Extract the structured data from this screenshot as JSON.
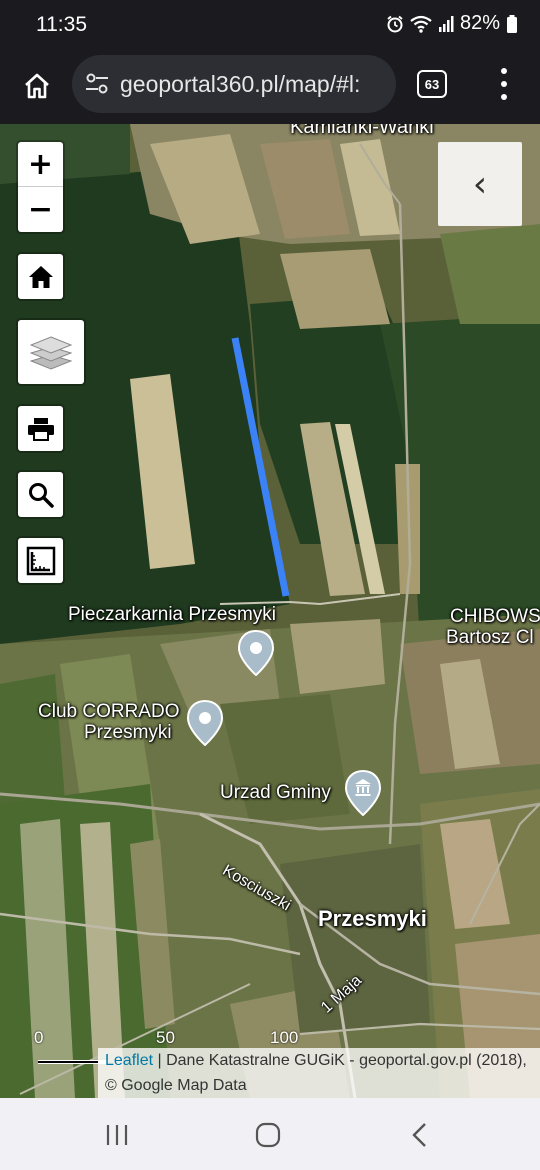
{
  "status_bar": {
    "time": "11:35",
    "battery": "82%",
    "icons": [
      "alarm-icon",
      "wifi-icon",
      "signal-icon",
      "battery-icon"
    ]
  },
  "browser": {
    "url": "geoportal360.pl/map/#l:",
    "tab_count": "63",
    "icons": [
      "home-icon",
      "site-settings-icon",
      "tabs-icon",
      "more-menu-icon"
    ]
  },
  "map": {
    "zoom_in_label": "+",
    "zoom_out_label": "−",
    "collapse_label": "‹",
    "controls": [
      "home-icon",
      "layers-icon",
      "print-icon",
      "search-icon",
      "measure-icon"
    ],
    "top_place": "Kamianki-Wańki",
    "labels": {
      "pieczarkarnia": "Pieczarkarnia Przesmyki",
      "chibowski_1": "CHIBOWS",
      "chibowski_2": "Bartosz Cl",
      "club_1": "Club CORRADO",
      "club_2": "Przesmyki",
      "urzad": "Urzad Gminy",
      "street_kosciuszki": "Kosciuszki",
      "town": "Przesmyki",
      "street_1maja": "1 Maja"
    },
    "scale": {
      "start": "0",
      "mid": "50",
      "end": "100"
    },
    "attribution": {
      "leaflet": "Leaflet",
      "text": " | Dane Katastralne GUGiK - geoportal.gov.pl (2018),",
      "text2": "© Google Map Data"
    },
    "route_color": "#3b82f6"
  },
  "nav_bar": {
    "icons": [
      "recents-icon",
      "home-circle-icon",
      "back-icon"
    ]
  }
}
